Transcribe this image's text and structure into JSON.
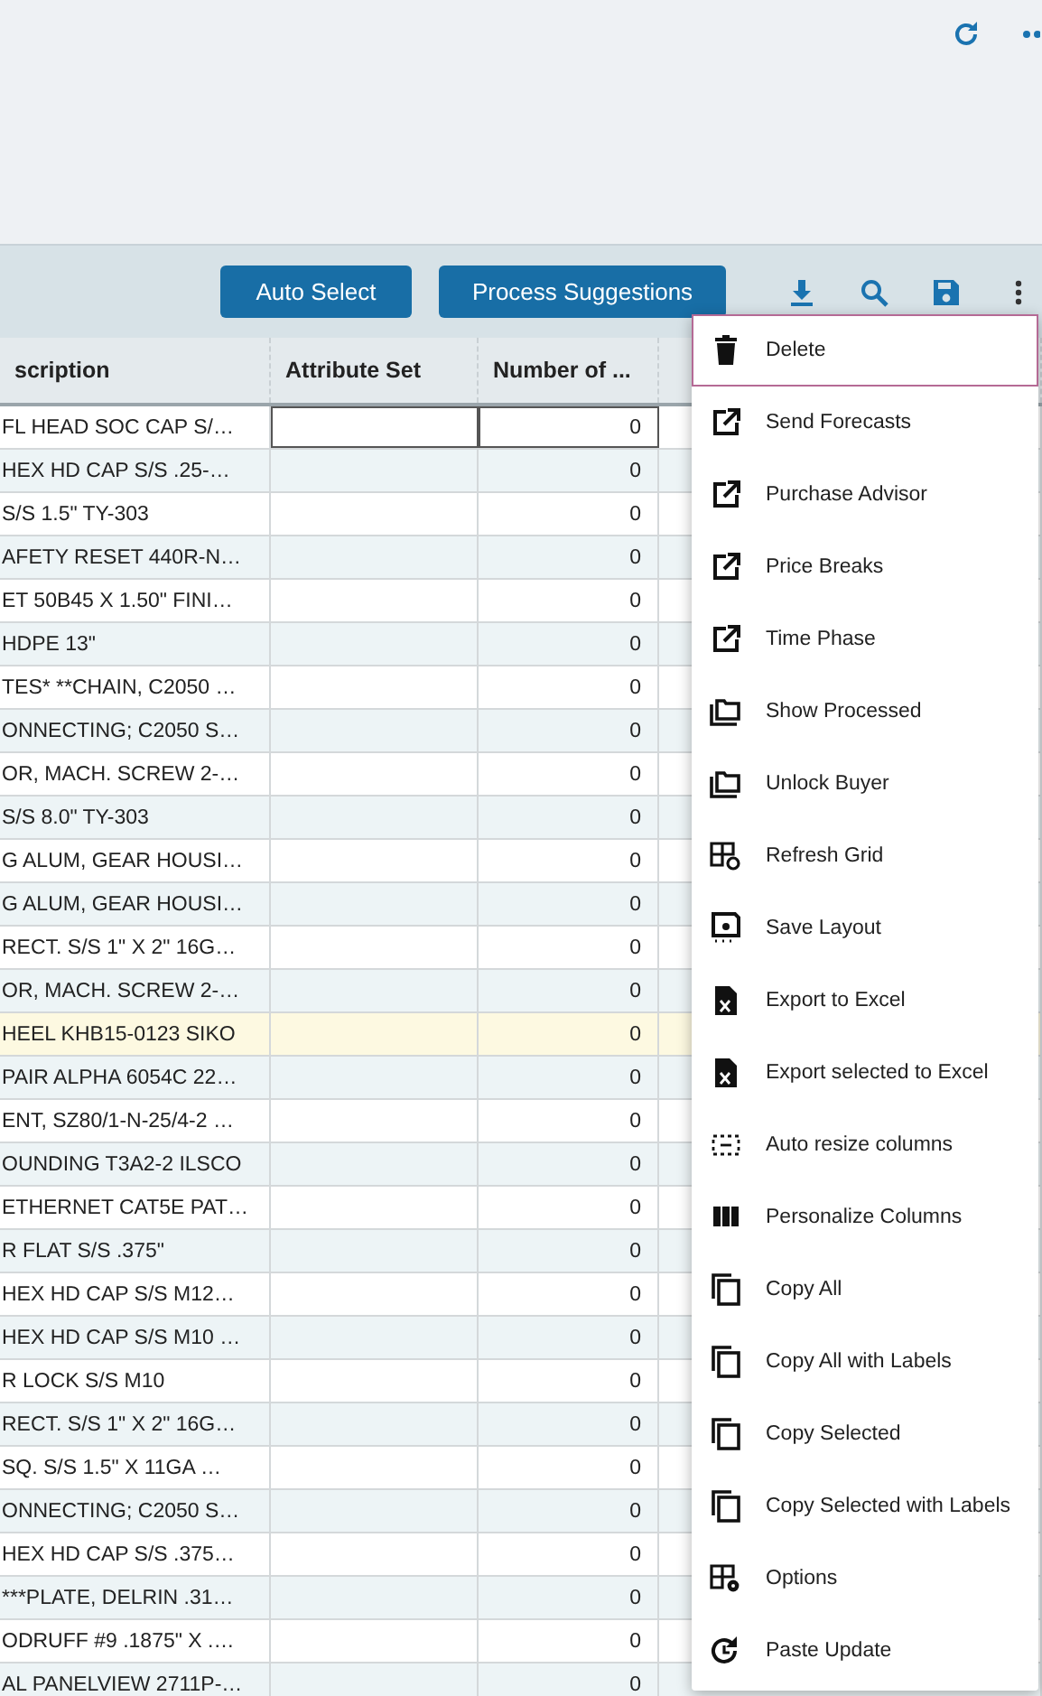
{
  "toolbar": {
    "buttons": [
      "Auto Select",
      "Process Suggestions"
    ]
  },
  "table": {
    "columns": [
      "scription",
      "Attribute Set",
      "Number of ..."
    ],
    "rows": [
      {
        "description": "FL HEAD SOC CAP S/…",
        "number": "0",
        "focused": true,
        "selected": false
      },
      {
        "description": "HEX HD CAP S/S .25-…",
        "number": "0",
        "focused": false,
        "selected": false
      },
      {
        "description": "S/S 1.5\" TY-303",
        "number": "0",
        "focused": false,
        "selected": false
      },
      {
        "description": "AFETY RESET 440R-N…",
        "number": "0",
        "focused": false,
        "selected": false
      },
      {
        "description": "ET 50B45 X 1.50\" FINI…",
        "number": "0",
        "focused": false,
        "selected": false
      },
      {
        "description": "HDPE 13\"",
        "number": "0",
        "focused": false,
        "selected": false
      },
      {
        "description": "TES* **CHAIN, C2050 …",
        "number": "0",
        "focused": false,
        "selected": false
      },
      {
        "description": "ONNECTING; C2050 S…",
        "number": "0",
        "focused": false,
        "selected": false
      },
      {
        "description": "OR, MACH. SCREW 2-…",
        "number": "0",
        "focused": false,
        "selected": false
      },
      {
        "description": "S/S 8.0\" TY-303",
        "number": "0",
        "focused": false,
        "selected": false
      },
      {
        "description": "G ALUM, GEAR HOUSI…",
        "number": "0",
        "focused": false,
        "selected": false
      },
      {
        "description": "G ALUM, GEAR HOUSI…",
        "number": "0",
        "focused": false,
        "selected": false
      },
      {
        "description": "RECT. S/S 1\" X 2\" 16G…",
        "number": "0",
        "focused": false,
        "selected": false
      },
      {
        "description": "OR, MACH. SCREW 2-…",
        "number": "0",
        "focused": false,
        "selected": false
      },
      {
        "description": "HEEL KHB15-0123 SIKO",
        "number": "0",
        "focused": false,
        "selected": true
      },
      {
        "description": "PAIR ALPHA 6054C 22…",
        "number": "0",
        "focused": false,
        "selected": false
      },
      {
        "description": "ENT, SZ80/1-N-25/4-2 …",
        "number": "0",
        "focused": false,
        "selected": false
      },
      {
        "description": "OUNDING T3A2-2 ILSCO",
        "number": "0",
        "focused": false,
        "selected": false
      },
      {
        "description": "ETHERNET CAT5E PAT…",
        "number": "0",
        "focused": false,
        "selected": false
      },
      {
        "description": "R FLAT S/S .375\"",
        "number": "0",
        "focused": false,
        "selected": false
      },
      {
        "description": "HEX HD CAP S/S M12…",
        "number": "0",
        "focused": false,
        "selected": false
      },
      {
        "description": "HEX HD CAP S/S M10 …",
        "number": "0",
        "focused": false,
        "selected": false
      },
      {
        "description": "R LOCK S/S M10",
        "number": "0",
        "focused": false,
        "selected": false
      },
      {
        "description": "RECT. S/S 1\" X 2\" 16G…",
        "number": "0",
        "focused": false,
        "selected": false
      },
      {
        "description": "SQ. S/S 1.5\" X 11GA …",
        "number": "0",
        "focused": false,
        "selected": false
      },
      {
        "description": "ONNECTING; C2050 S…",
        "number": "0",
        "focused": false,
        "selected": false
      },
      {
        "description": "HEX HD CAP S/S .375…",
        "number": "0",
        "focused": false,
        "selected": false
      },
      {
        "description": "***PLATE, DELRIN .31…",
        "number": "0",
        "focused": false,
        "selected": false
      },
      {
        "description": "ODRUFF #9 .1875\" X .…",
        "number": "0",
        "focused": false,
        "selected": false
      },
      {
        "description": "AL PANELVIEW 2711P-…",
        "number": "0",
        "focused": false,
        "selected": false
      }
    ]
  },
  "menu": {
    "items": [
      {
        "label": "Delete",
        "kind": "delete",
        "selected": true
      },
      {
        "label": "Send Forecasts",
        "kind": "link",
        "selected": false
      },
      {
        "label": "Purchase Advisor",
        "kind": "link",
        "selected": false
      },
      {
        "label": "Price Breaks",
        "kind": "link",
        "selected": false
      },
      {
        "label": "Time Phase",
        "kind": "link",
        "selected": false
      },
      {
        "label": "Show Processed",
        "kind": "folder",
        "selected": false
      },
      {
        "label": "Unlock Buyer",
        "kind": "folder",
        "selected": false
      },
      {
        "label": "Refresh Grid",
        "kind": "refresh",
        "selected": false
      },
      {
        "label": "Save Layout",
        "kind": "save",
        "selected": false
      },
      {
        "label": "Export to Excel",
        "kind": "excel",
        "selected": false
      },
      {
        "label": "Export selected to Excel",
        "kind": "excel",
        "selected": false
      },
      {
        "label": "Auto resize columns",
        "kind": "resize",
        "selected": false
      },
      {
        "label": "Personalize Columns",
        "kind": "columns",
        "selected": false
      },
      {
        "label": "Copy All",
        "kind": "copy",
        "selected": false
      },
      {
        "label": "Copy All with Labels",
        "kind": "copy",
        "selected": false
      },
      {
        "label": "Copy Selected",
        "kind": "copy",
        "selected": false
      },
      {
        "label": "Copy Selected with Labels",
        "kind": "copy",
        "selected": false
      },
      {
        "label": "Options",
        "kind": "options",
        "selected": false
      },
      {
        "label": "Paste Update",
        "kind": "history",
        "selected": false
      }
    ]
  }
}
